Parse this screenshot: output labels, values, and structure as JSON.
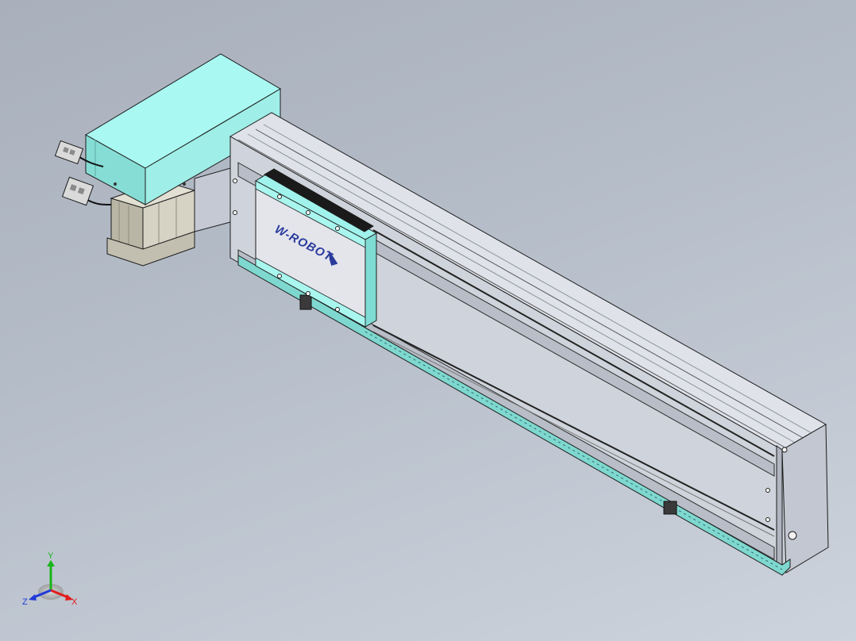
{
  "viewport": {
    "background_top": "#a9b0bc",
    "background_bottom": "#cdd3dc"
  },
  "model": {
    "logo_text": "W-ROBOT",
    "colors": {
      "aluminum": "#d2d6df",
      "aluminum_dark": "#a9aeba",
      "cover_cyan": "#9ff3ec",
      "cover_cyan_dark": "#6cc6bf",
      "motor": "#c9c7b9",
      "carriage_body": "#e0e2e8",
      "logo_blue": "#2a3b9c",
      "edges": "#1c1c1c"
    }
  },
  "triad": {
    "x_label": "X",
    "y_label": "Y",
    "z_label": "Z",
    "x_color": "#e21c1c",
    "y_color": "#19b419",
    "z_color": "#1f3ad8"
  }
}
